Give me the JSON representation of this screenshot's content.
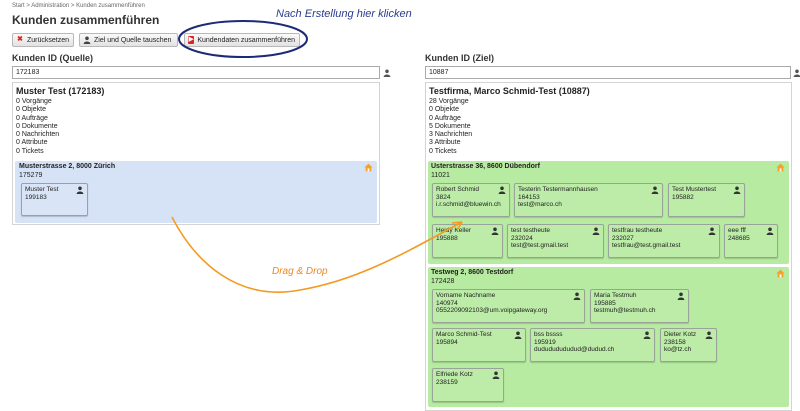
{
  "breadcrumb": {
    "items": [
      "Start",
      "Administration",
      "Kunden zusammenführen"
    ],
    "separator": ">"
  },
  "page_title": "Kunden zusammenführen",
  "toolbar": {
    "reset_label": "Zurücksetzen",
    "swap_label": "Ziel und Quelle tauschen",
    "merge_label": "Kundendaten zusammenführen"
  },
  "annotation": {
    "text": "Nach Erstellung hier klicken",
    "color": "#2a3c8f"
  },
  "drag_label": {
    "text": "Drag & Drop",
    "color": "#e8871e"
  },
  "colors": {
    "source_address_bg": "#d6e3f7",
    "target_address_bg": "#b7eba1",
    "annotation_ellipse": "#1c2a78",
    "arrow": "#f39a21",
    "reset_icon": "#dd2222",
    "merge_icon": "#dd2222"
  },
  "source": {
    "label": "Kunden ID (Quelle)",
    "input_value": "172183",
    "name": "Muster Test (172183)",
    "stats": [
      "0 Vorgänge",
      "0 Objekte",
      "0 Aufträge",
      "0 Dokumente",
      "0 Nachrichten",
      "0 Attribute",
      "0 Tickets"
    ],
    "addresses": [
      {
        "title": "Musterstrasse 2, 8000 Zürich",
        "number": "175279",
        "contacts": [
          {
            "name": "Muster Test",
            "id": "199183",
            "email": ""
          }
        ]
      }
    ]
  },
  "target": {
    "label": "Kunden ID (Ziel)",
    "input_value": "10887",
    "name": "Testfirma, Marco Schmid-Test (10887)",
    "stats": [
      "28 Vorgänge",
      "0 Objekte",
      "0 Aufträge",
      "5 Dokumente",
      "3 Nachrichten",
      "3 Attribute",
      "0 Tickets"
    ],
    "addresses": [
      {
        "title": "Usterstrasse 36, 8600 Dübendorf",
        "number": "11021",
        "contacts": [
          {
            "name": "Robert Schmid",
            "id": "3824",
            "email": "i.r.schmid@bluewin.ch"
          },
          {
            "name": "Testerin Testermannhausen",
            "id": "164153",
            "email": "test@marco.ch"
          },
          {
            "name": "Test Mustertest",
            "id": "195882",
            "email": ""
          },
          {
            "name": "Heidy Keller",
            "id": "195888",
            "email": ""
          },
          {
            "name": "test testheute",
            "id": "232024",
            "email": "test@test.gmail.test"
          },
          {
            "name": "testfrau testheute",
            "id": "232027",
            "email": "testfrau@test.gmail.test"
          },
          {
            "name": "eee fff",
            "id": "248685",
            "email": ""
          }
        ]
      },
      {
        "title": "Testweg 2, 8600 Testdorf",
        "number": "172428",
        "contacts": [
          {
            "name": "Vorname Nachname",
            "id": "140974",
            "email": "0552209092103@um.voipgateway.org"
          },
          {
            "name": "Maria Testmuh",
            "id": "195885",
            "email": "testmuh@testmuh.ch"
          },
          {
            "name": "Marco Schmid-Test",
            "id": "195894",
            "email": ""
          },
          {
            "name": "bss bssss",
            "id": "195919",
            "email": "dudududududud@dudud.ch"
          },
          {
            "name": "Dieter Kotz",
            "id": "238158",
            "email": "ko@tz.ch"
          },
          {
            "name": "Elfriede Kotz",
            "id": "238159",
            "email": ""
          }
        ]
      }
    ]
  }
}
